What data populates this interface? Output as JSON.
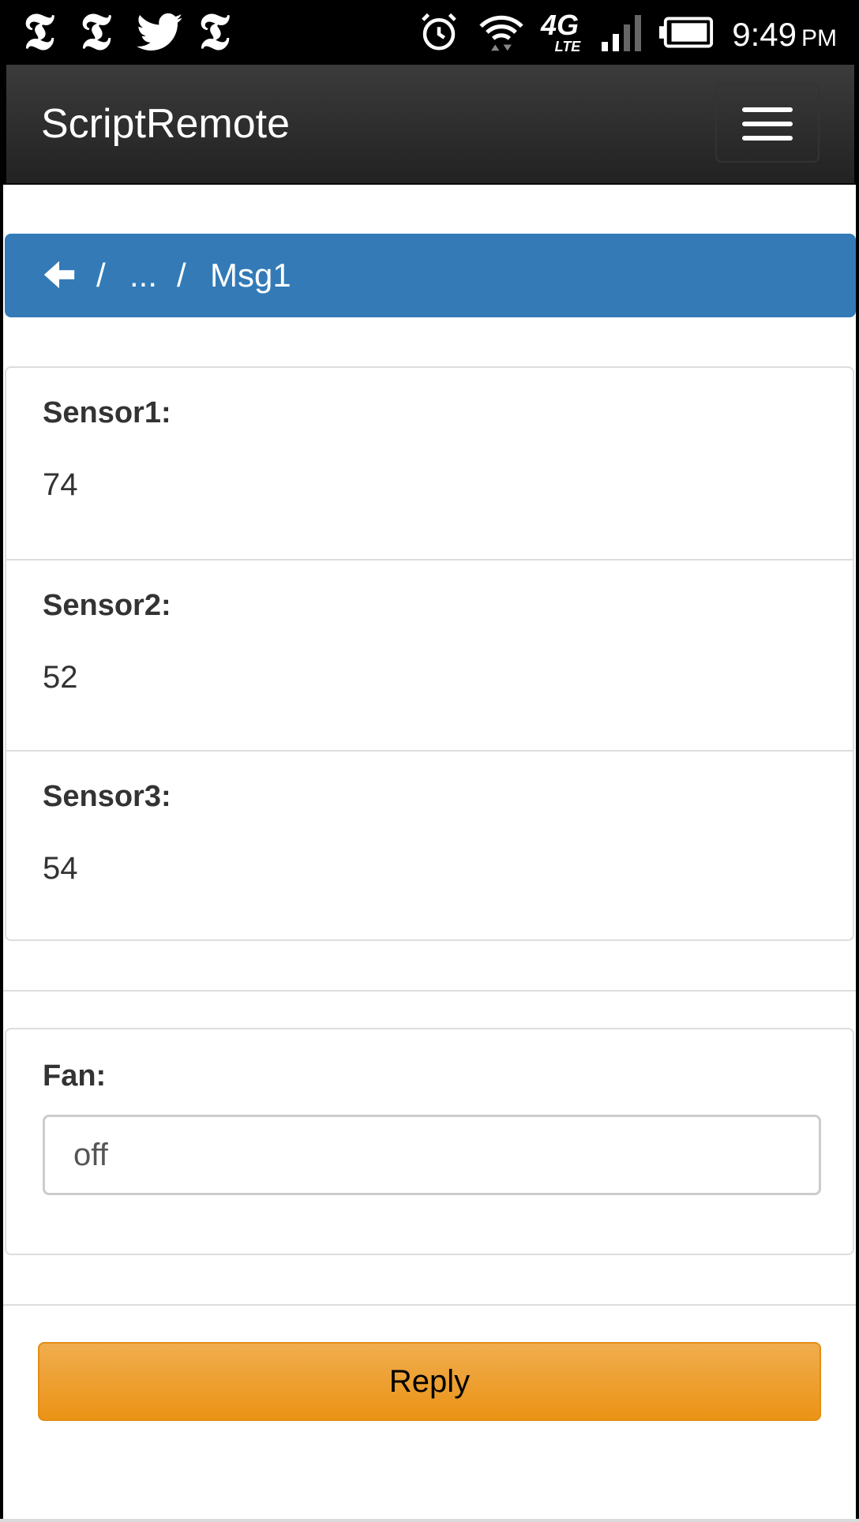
{
  "status_bar": {
    "notification_icons": [
      "nyt-icon",
      "nyt-icon",
      "twitter-icon",
      "nyt-icon"
    ],
    "nyt_glyph": "𝕿",
    "system_icons": [
      "alarm-icon",
      "wifi-icon",
      "4g-lte-icon",
      "signal-icon",
      "battery-icon"
    ],
    "network_label": "4G",
    "network_sub": "LTE",
    "time": "9:49",
    "ampm": "PM"
  },
  "navbar": {
    "brand": "ScriptRemote",
    "menu_icon": "hamburger-menu-icon"
  },
  "breadcrumb": {
    "back_icon": "arrow-left-icon",
    "separator": "/",
    "ellipsis": "...",
    "current": "Msg1",
    "background_color": "#337ab7"
  },
  "sensors": [
    {
      "label": "Sensor1:",
      "value": "74"
    },
    {
      "label": "Sensor2:",
      "value": "52"
    },
    {
      "label": "Sensor3:",
      "value": "54"
    }
  ],
  "fan": {
    "label": "Fan:",
    "value": "off"
  },
  "reply_button": {
    "label": "Reply",
    "color": "#f0ad4e"
  }
}
